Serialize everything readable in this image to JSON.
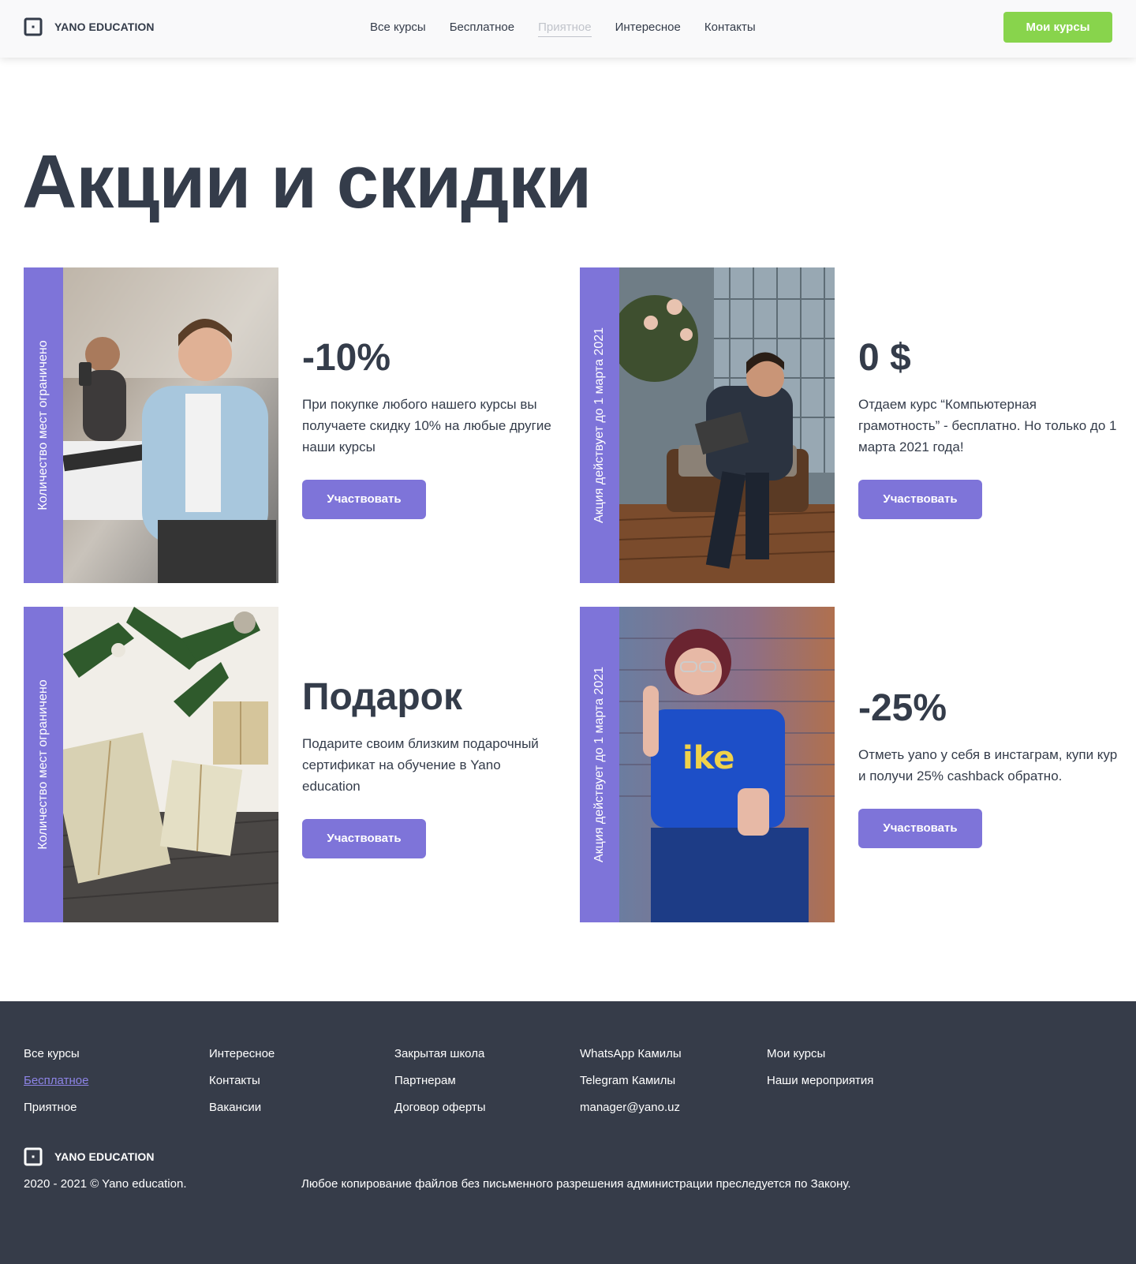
{
  "brand": {
    "name": "YANO EDUCATION"
  },
  "nav": {
    "items": [
      "Все курсы",
      "Бесплатное",
      "Приятное",
      "Интересное",
      "Контакты"
    ],
    "cta": "Мои курсы"
  },
  "page": {
    "title": "Акции и скидки"
  },
  "colors": {
    "accent": "#7e74d9",
    "cta": "#88d44c",
    "text": "#343c4a",
    "footer_bg": "#363c49"
  },
  "promos": [
    {
      "ribbon": "Количество мест ограничено",
      "title": "-10%",
      "text": "При покупке любого нашего курсы вы получаете скидку 10% на любые другие наши курсы",
      "button": "Участвовать",
      "image": "man-with-phone-photo"
    },
    {
      "ribbon": "Акция действует до 1 марта 2021",
      "title": "0 $",
      "text": "Отдаем курс “Компьютерная грамотность” - бесплатно. Но только до 1 марта 2021 года!",
      "button": "Участвовать",
      "image": "man-with-laptop-photo"
    },
    {
      "ribbon": "Количество мест ограничено",
      "title": "Подарок",
      "text": "Подарите своим близким подарочный сертификат на обучение в Yano education",
      "button": "Участвовать",
      "image": "gift-boxes-photo"
    },
    {
      "ribbon": "Акция действует до 1 марта 2021",
      "title": "-25%",
      "text": "Отметь yano у себя в инстаграм, купи кур и получи 25% cashback обратно.",
      "button": "Участвовать",
      "image": "woman-with-glasses-photo"
    }
  ],
  "footer": {
    "col1": [
      "Все курсы",
      "Бесплатное",
      "Приятное"
    ],
    "col2": [
      "Интересное",
      "Контакты",
      "Вакансии"
    ],
    "col3": [
      "Закрытая школа",
      "Партнерам",
      "Договор оферты"
    ],
    "col4": [
      "WhatsApp Камилы",
      "Telegram Камилы",
      "manager@yano.uz"
    ],
    "col5": [
      "Мои курсы",
      "Наши мероприятия"
    ],
    "copyright": "2020 - 2021 © Yano education.",
    "legal": "Любое копирование файлов без письменного разрешения администрации преследуется по Закону."
  }
}
